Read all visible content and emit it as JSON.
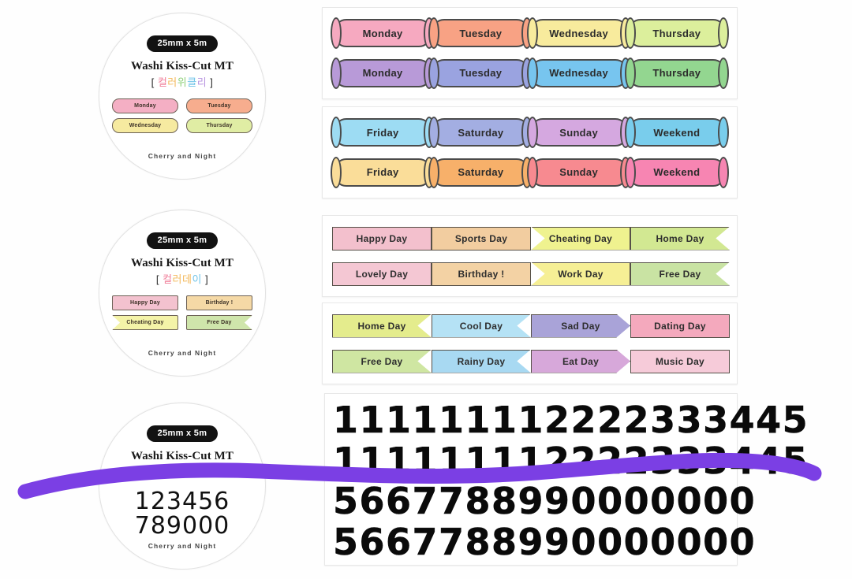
{
  "page": {
    "background": "#fefefe",
    "accent_purple": "#7b3fe4"
  },
  "product_labels": [
    {
      "size": "25mm x 5m",
      "brand_title": "Washi Kiss-Cut MT",
      "korean_name": "컬러위클리",
      "korean_display": "[ 컬러위클리 ]",
      "footer": "Cherry and Night",
      "preview_style": "cloud",
      "preview": [
        {
          "label": "Monday",
          "color": "#f4afc4"
        },
        {
          "label": "Tuesday",
          "color": "#f7ad8e"
        },
        {
          "label": "Wednesday",
          "color": "#f6eaa0"
        },
        {
          "label": "Thursday",
          "color": "#e0eda4"
        }
      ]
    },
    {
      "size": "25mm x 5m",
      "brand_title": "Washi Kiss-Cut MT",
      "korean_name": "컬러데이",
      "korean_display": "[ 컬러데이 ]",
      "footer": "Cherry and Night",
      "preview_style": "ribbon",
      "preview": [
        {
          "label": "Happy Day",
          "color": "#f3c2cf",
          "shape": "zig"
        },
        {
          "label": "Birthday !",
          "color": "#f5d9a6",
          "shape": "zig"
        },
        {
          "label": "Cheating Day",
          "color": "#f4f3a8",
          "shape": "flag-r-notch"
        },
        {
          "label": "Free Day",
          "color": "#cfe5ab",
          "shape": "flag-r-notch"
        }
      ]
    },
    {
      "size": "25mm x 5m",
      "brand_title": "Washi Kiss-Cut MT",
      "korean_name": "숫자",
      "korean_display": "[ 숫자 ]",
      "footer": "Cherry and Night",
      "preview_style": "numbers",
      "number_rows": [
        "123456",
        "789000"
      ]
    }
  ],
  "sheets": [
    {
      "id": "weekday-sheet-1",
      "rows": [
        [
          {
            "label": "Monday",
            "color": "#f6a9c0"
          },
          {
            "label": "Tuesday",
            "color": "#f8a284"
          },
          {
            "label": "Wednesday",
            "color": "#f8eb9d"
          },
          {
            "label": "Thursday",
            "color": "#dcef9c"
          }
        ],
        [
          {
            "label": "Monday",
            "color": "#b89ad8"
          },
          {
            "label": "Tuesday",
            "color": "#9aa3e0"
          },
          {
            "label": "Wednesday",
            "color": "#77c5ef"
          },
          {
            "label": "Thursday",
            "color": "#93d690"
          }
        ]
      ]
    },
    {
      "id": "weekday-sheet-2",
      "rows": [
        [
          {
            "label": "Friday",
            "color": "#9ddcf3"
          },
          {
            "label": "Saturday",
            "color": "#a3aee2"
          },
          {
            "label": "Sunday",
            "color": "#d5a8e0"
          },
          {
            "label": "Weekend",
            "color": "#79cdec"
          }
        ],
        [
          {
            "label": "Friday",
            "color": "#fadd99"
          },
          {
            "label": "Saturday",
            "color": "#f7b06a"
          },
          {
            "label": "Sunday",
            "color": "#f78a90"
          },
          {
            "label": "Weekend",
            "color": "#f785b2"
          }
        ]
      ]
    },
    {
      "id": "day-label-sheet-1",
      "rows": [
        [
          {
            "label": "Happy Day",
            "color": "#f3c0cd",
            "shape": "zig"
          },
          {
            "label": "Sports Day",
            "color": "#f2cda0",
            "shape": "zig"
          },
          {
            "label": "Cheating Day",
            "color": "#eff28f",
            "shape": "flag-r-notch"
          },
          {
            "label": "Home Day",
            "color": "#d2e892",
            "shape": "flag-r-notch"
          }
        ],
        [
          {
            "label": "Lovely Day",
            "color": "#f4c7d3",
            "shape": "zig"
          },
          {
            "label": "Birthday !",
            "color": "#f3d2a4",
            "shape": "zig"
          },
          {
            "label": "Work Day",
            "color": "#f6ef95",
            "shape": "flag-l-notch"
          },
          {
            "label": "Free Day",
            "color": "#c9e3a3",
            "shape": "flag-r-notch"
          }
        ]
      ]
    },
    {
      "id": "day-label-sheet-2",
      "rows": [
        [
          {
            "label": "Home Day",
            "color": "#e4ec8d",
            "shape": "flag-r-notch"
          },
          {
            "label": "Cool Day",
            "color": "#b5e2f5",
            "shape": "flag-r-notch"
          },
          {
            "label": "Sad Day",
            "color": "#a9a3d8",
            "shape": "arrow-r"
          },
          {
            "label": "Dating Day",
            "color": "#f4a9bd",
            "shape": "zig"
          }
        ],
        [
          {
            "label": "Free Day",
            "color": "#cfe6a2",
            "shape": "flag-r-notch"
          },
          {
            "label": "Rainy Day",
            "color": "#a8d9f2",
            "shape": "flag-r-notch"
          },
          {
            "label": "Eat Day",
            "color": "#d7a8da",
            "shape": "arrow-r"
          },
          {
            "label": "Music Day",
            "color": "#f6cbd9",
            "shape": "zig"
          }
        ]
      ]
    }
  ],
  "number_sheet": {
    "id": "number-sheet",
    "rows": [
      "111111112222333445",
      "111111112222333445",
      "5667788990000000",
      "5667788990000000"
    ]
  }
}
